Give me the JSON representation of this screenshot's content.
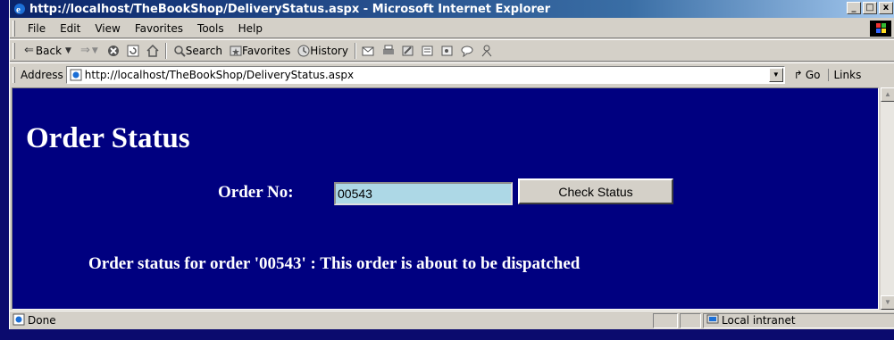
{
  "window": {
    "title": "http://localhost/TheBookShop/DeliveryStatus.aspx - Microsoft Internet Explorer",
    "minimize": "_",
    "maximize": "□",
    "close": "x"
  },
  "menu": {
    "items": [
      "File",
      "Edit",
      "View",
      "Favorites",
      "Tools",
      "Help"
    ]
  },
  "toolbar": {
    "back_label": "Back",
    "search_label": "Search",
    "favorites_label": "Favorites",
    "history_label": "History"
  },
  "address": {
    "label": "Address",
    "url": "http://localhost/TheBookShop/DeliveryStatus.aspx",
    "go_label": "Go",
    "links_label": "Links"
  },
  "page": {
    "title": "Order Status",
    "order_label": "Order No:",
    "order_value": "00543",
    "check_button": "Check Status",
    "status_message": "Order status for order '00543' : This order is about to be dispatched"
  },
  "statusbar": {
    "status": "Done",
    "zone": "Local intranet"
  },
  "colors": {
    "page_background": "#000080",
    "input_background": "#add8e6"
  }
}
